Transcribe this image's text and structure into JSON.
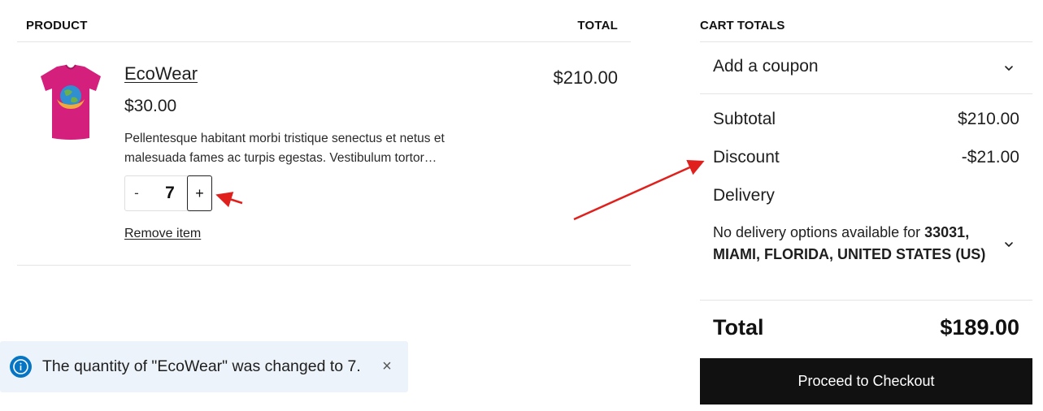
{
  "cart": {
    "headers": {
      "product": "Product",
      "total": "Total"
    },
    "item": {
      "name": "EcoWear",
      "price": "$30.00",
      "description": "Pellentesque habitant morbi tristique senectus et netus et malesuada fames ac turpis egestas. Vestibulum tortor…",
      "quantity": "7",
      "minus_label": "-",
      "plus_label": "+",
      "remove_label": "Remove item",
      "row_total": "$210.00",
      "thumbnail_icon": "tshirt-icon",
      "shirt_color": "#d41f7d"
    }
  },
  "totals": {
    "title": "Cart totals",
    "coupon_label": "Add a coupon",
    "subtotal_label": "Subtotal",
    "subtotal_value": "$210.00",
    "discount_label": "Discount",
    "discount_value": "-$21.00",
    "delivery_label": "Delivery",
    "delivery_prefix": "No delivery options available for ",
    "delivery_location": "33031, MIAMI, FLORIDA, UNITED STATES (US)",
    "total_label": "Total",
    "total_value": "$189.00",
    "checkout_label": "Proceed to Checkout"
  },
  "notice": {
    "text": "The quantity of \"EcoWear\" was changed to 7.",
    "close_label": "×",
    "icon": "info-icon",
    "accent": "#0675c4"
  },
  "colors": {
    "checkout_bg": "#111111",
    "notice_bg": "#edf3fa",
    "annotation_arrow": "#e0201c"
  }
}
